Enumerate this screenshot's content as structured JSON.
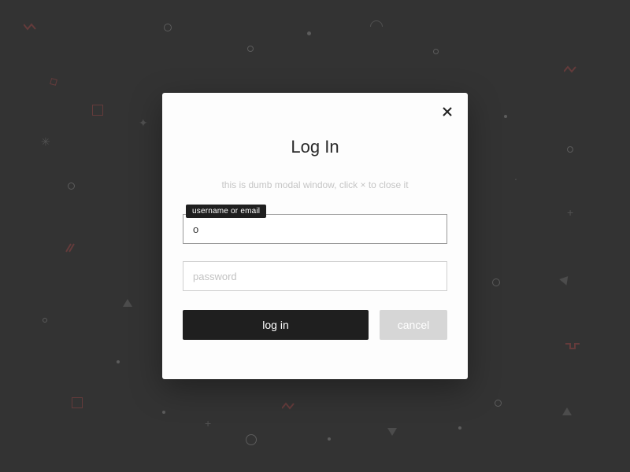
{
  "modal": {
    "title": "Log In",
    "subtitle": "this is dumb modal window, click × to close it",
    "username": {
      "label": "username or email",
      "value": "o",
      "placeholder": ""
    },
    "password": {
      "placeholder": "password",
      "value": ""
    },
    "login_label": "log in",
    "cancel_label": "cancel"
  }
}
